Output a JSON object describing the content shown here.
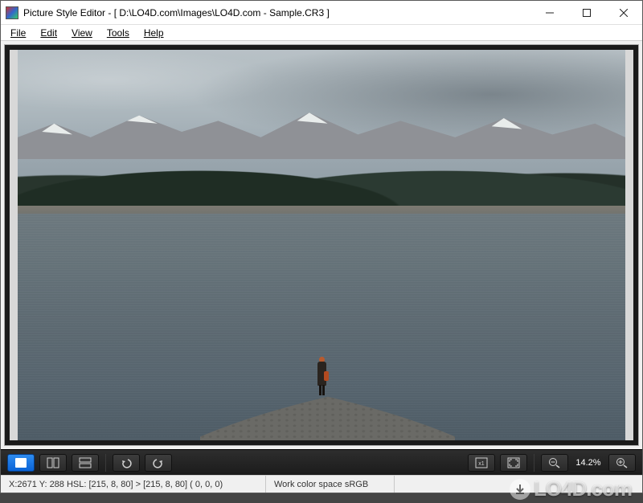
{
  "window": {
    "title": "Picture Style Editor - [ D:\\LO4D.com\\Images\\LO4D.com - Sample.CR3 ]"
  },
  "menu": {
    "file": "File",
    "edit": "Edit",
    "view": "View",
    "tools": "Tools",
    "help": "Help"
  },
  "toolbar": {
    "zoom_label": "14.2%"
  },
  "status": {
    "coords": "X:2671 Y: 288  HSL: [215,  8, 80] > [215,  8, 80]  (  0,  0,  0)",
    "colorspace": "Work color space  sRGB"
  },
  "watermark": {
    "text": "LO4D.com"
  }
}
